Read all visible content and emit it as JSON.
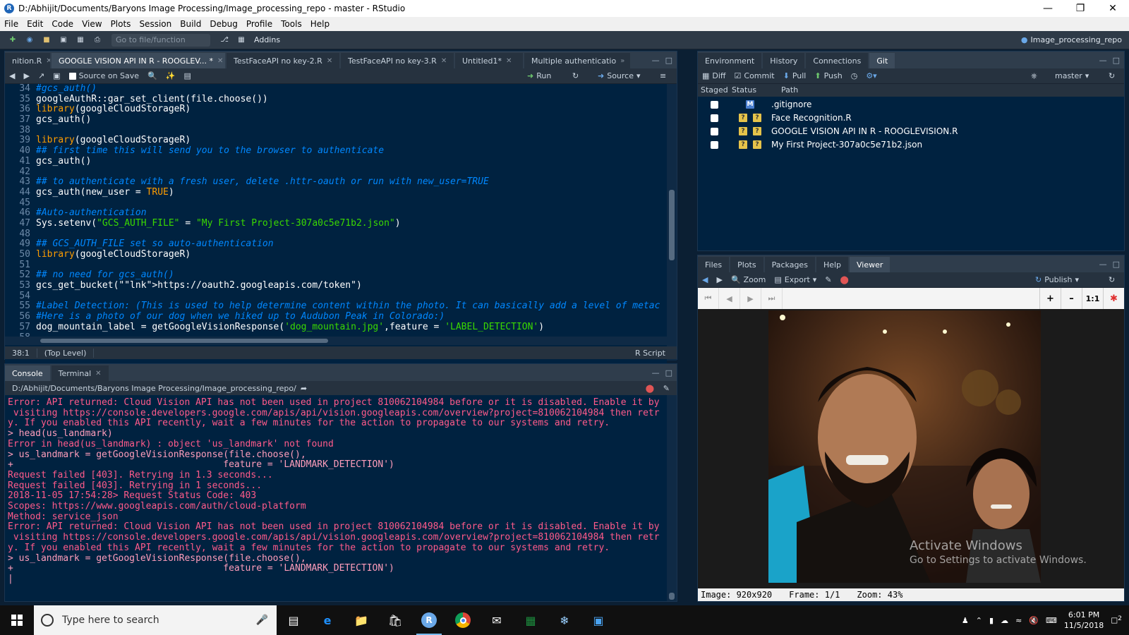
{
  "window": {
    "title": "D:/Abhijit/Documents/Baryons Image Processing/Image_processing_repo - master - RStudio"
  },
  "menu": [
    "File",
    "Edit",
    "Code",
    "View",
    "Plots",
    "Session",
    "Build",
    "Debug",
    "Profile",
    "Tools",
    "Help"
  ],
  "toolbar": {
    "goto_placeholder": "Go to file/function",
    "addins": "Addins",
    "project": "Image_processing_repo"
  },
  "editor": {
    "tabs": [
      {
        "label": "nition.R"
      },
      {
        "label": "GOOGLE VISION API IN R - ROOGLEV... *"
      },
      {
        "label": "TestFaceAPI no key-2.R"
      },
      {
        "label": "TestFaceAPI no key-3.R"
      },
      {
        "label": "Untitled1*"
      },
      {
        "label": "Multiple authenticatio"
      }
    ],
    "source_on_save": "Source on Save",
    "run": "Run",
    "source": "Source",
    "lines": [
      {
        "n": "34",
        "t": "#gcs_auth()",
        "c": "cmt"
      },
      {
        "n": "35",
        "t": "googleAuthR::gar_set_client(file.choose())",
        "c": "code"
      },
      {
        "n": "36",
        "t": "library(googleCloudStorageR)",
        "c": "code"
      },
      {
        "n": "37",
        "t": "gcs_auth()",
        "c": "code"
      },
      {
        "n": "38",
        "t": "",
        "c": "code"
      },
      {
        "n": "39",
        "t": "library(googleCloudStorageR)",
        "c": "code"
      },
      {
        "n": "40",
        "t": "## first time this will send you to the browser to authenticate",
        "c": "cmt"
      },
      {
        "n": "41",
        "t": "gcs_auth()",
        "c": "code"
      },
      {
        "n": "42",
        "t": "",
        "c": "code"
      },
      {
        "n": "43",
        "t": "## to authenticate with a fresh user, delete .httr-oauth or run with new_user=TRUE",
        "c": "cmt"
      },
      {
        "n": "44",
        "t": "gcs_auth(new_user = TRUE)",
        "c": "code"
      },
      {
        "n": "45",
        "t": "",
        "c": "code"
      },
      {
        "n": "46",
        "t": "#Auto-authentication",
        "c": "cmt"
      },
      {
        "n": "47",
        "t": "Sys.setenv(\"GCS_AUTH_FILE\" = \"My First Project-307a0c5e71b2.json\")",
        "c": "code"
      },
      {
        "n": "48",
        "t": "",
        "c": "code"
      },
      {
        "n": "49",
        "t": "## GCS_AUTH_FILE set so auto-authentication",
        "c": "cmt"
      },
      {
        "n": "50",
        "t": "library(googleCloudStorageR)",
        "c": "code"
      },
      {
        "n": "51",
        "t": "",
        "c": "code"
      },
      {
        "n": "52",
        "t": "## no need for gcs_auth()",
        "c": "cmt"
      },
      {
        "n": "53",
        "t": "gcs_get_bucket(\"https://oauth2.googleapis.com/token\")",
        "c": "code"
      },
      {
        "n": "54",
        "t": "",
        "c": "code"
      },
      {
        "n": "55",
        "t": "#Label Detection: (This is used to help determine content within the photo. It can basically add a level of metac",
        "c": "cmt"
      },
      {
        "n": "56",
        "t": "#Here is a photo of our dog when we hiked up to Audubon Peak in Colorado:)",
        "c": "cmt"
      },
      {
        "n": "57",
        "t": "dog_mountain_label = getGoogleVisionResponse('dog_mountain.jpg',feature = 'LABEL_DETECTION')",
        "c": "code"
      },
      {
        "n": "58",
        "t": "",
        "c": "code"
      }
    ],
    "status": {
      "pos": "38:1",
      "scope": "(Top Level)",
      "type": "R Script"
    }
  },
  "console": {
    "tabs": [
      "Console",
      "Terminal"
    ],
    "path": "D:/Abhijit/Documents/Baryons Image Processing/Image_processing_repo/",
    "lines": [
      {
        "t": "Error: API returned: Cloud Vision API has not been used in project 810062104984 before or it is disabled. Enable it by",
        "c": "err"
      },
      {
        "t": " visiting https://console.developers.google.com/apis/api/vision.googleapis.com/overview?project=810062104984 then retr",
        "c": "err"
      },
      {
        "t": "y. If you enabled this API recently, wait a few minutes for the action to propagate to our systems and retry.",
        "c": "err"
      },
      {
        "t": "> head(us_landmark)",
        "c": "inp"
      },
      {
        "t": "Error in head(us_landmark) : object 'us_landmark' not found",
        "c": "err"
      },
      {
        "t": "> us_landmark = getGoogleVisionResponse(file.choose(),",
        "c": "inp"
      },
      {
        "t": "+                                      feature = 'LANDMARK_DETECTION')",
        "c": "inp"
      },
      {
        "t": "Request failed [403]. Retrying in 1.3 seconds...",
        "c": "msg"
      },
      {
        "t": "Request failed [403]. Retrying in 1 seconds...",
        "c": "msg"
      },
      {
        "t": "2018-11-05 17:54:28> Request Status Code: 403",
        "c": "msg"
      },
      {
        "t": "Scopes: https://www.googleapis.com/auth/cloud-platform",
        "c": "msg"
      },
      {
        "t": "Method: service_json",
        "c": "msg"
      },
      {
        "t": "Error: API returned: Cloud Vision API has not been used in project 810062104984 before or it is disabled. Enable it by",
        "c": "err"
      },
      {
        "t": " visiting https://console.developers.google.com/apis/api/vision.googleapis.com/overview?project=810062104984 then retr",
        "c": "err"
      },
      {
        "t": "y. If you enabled this API recently, wait a few minutes for the action to propagate to our systems and retry.",
        "c": "err"
      },
      {
        "t": "> us_landmark = getGoogleVisionResponse(file.choose(),",
        "c": "inp"
      },
      {
        "t": "+                                      feature = 'LANDMARK_DETECTION')",
        "c": "inp"
      },
      {
        "t": "|",
        "c": "inp"
      }
    ]
  },
  "git": {
    "tabs": [
      "Environment",
      "History",
      "Connections",
      "Git"
    ],
    "actions": {
      "diff": "Diff",
      "commit": "Commit",
      "pull": "Pull",
      "push": "Push",
      "branch": "master"
    },
    "headers": {
      "staged": "Staged",
      "status": "Status",
      "path": "Path"
    },
    "files": [
      {
        "path": ".gitignore",
        "status": [
          "M"
        ]
      },
      {
        "path": "Face Recognition.R",
        "status": [
          "?",
          "?"
        ]
      },
      {
        "path": "GOOGLE VISION API IN R - ROOGLEVISION.R",
        "status": [
          "?",
          "?"
        ]
      },
      {
        "path": "My First Project-307a0c5e71b2.json",
        "status": [
          "?",
          "?"
        ]
      }
    ]
  },
  "viewer": {
    "tabs": [
      "Files",
      "Plots",
      "Packages",
      "Help",
      "Viewer"
    ],
    "zoom": "Zoom",
    "export": "Export",
    "publish": "Publish",
    "ratio": "1:1",
    "watermark_title": "Activate Windows",
    "watermark_sub": "Go to Settings to activate Windows.",
    "status": {
      "image": "Image: 920x920",
      "frame": "Frame: 1/1",
      "zoom": "Zoom: 43%"
    }
  },
  "taskbar": {
    "search_placeholder": "Type here to search",
    "time": "6:01 PM",
    "date": "11/5/2018",
    "notifications": "2"
  },
  "colors": {
    "editor_bg": "#002240",
    "comment": "#0088ff",
    "string": "#3ad900",
    "error": "#ff5a8a"
  }
}
